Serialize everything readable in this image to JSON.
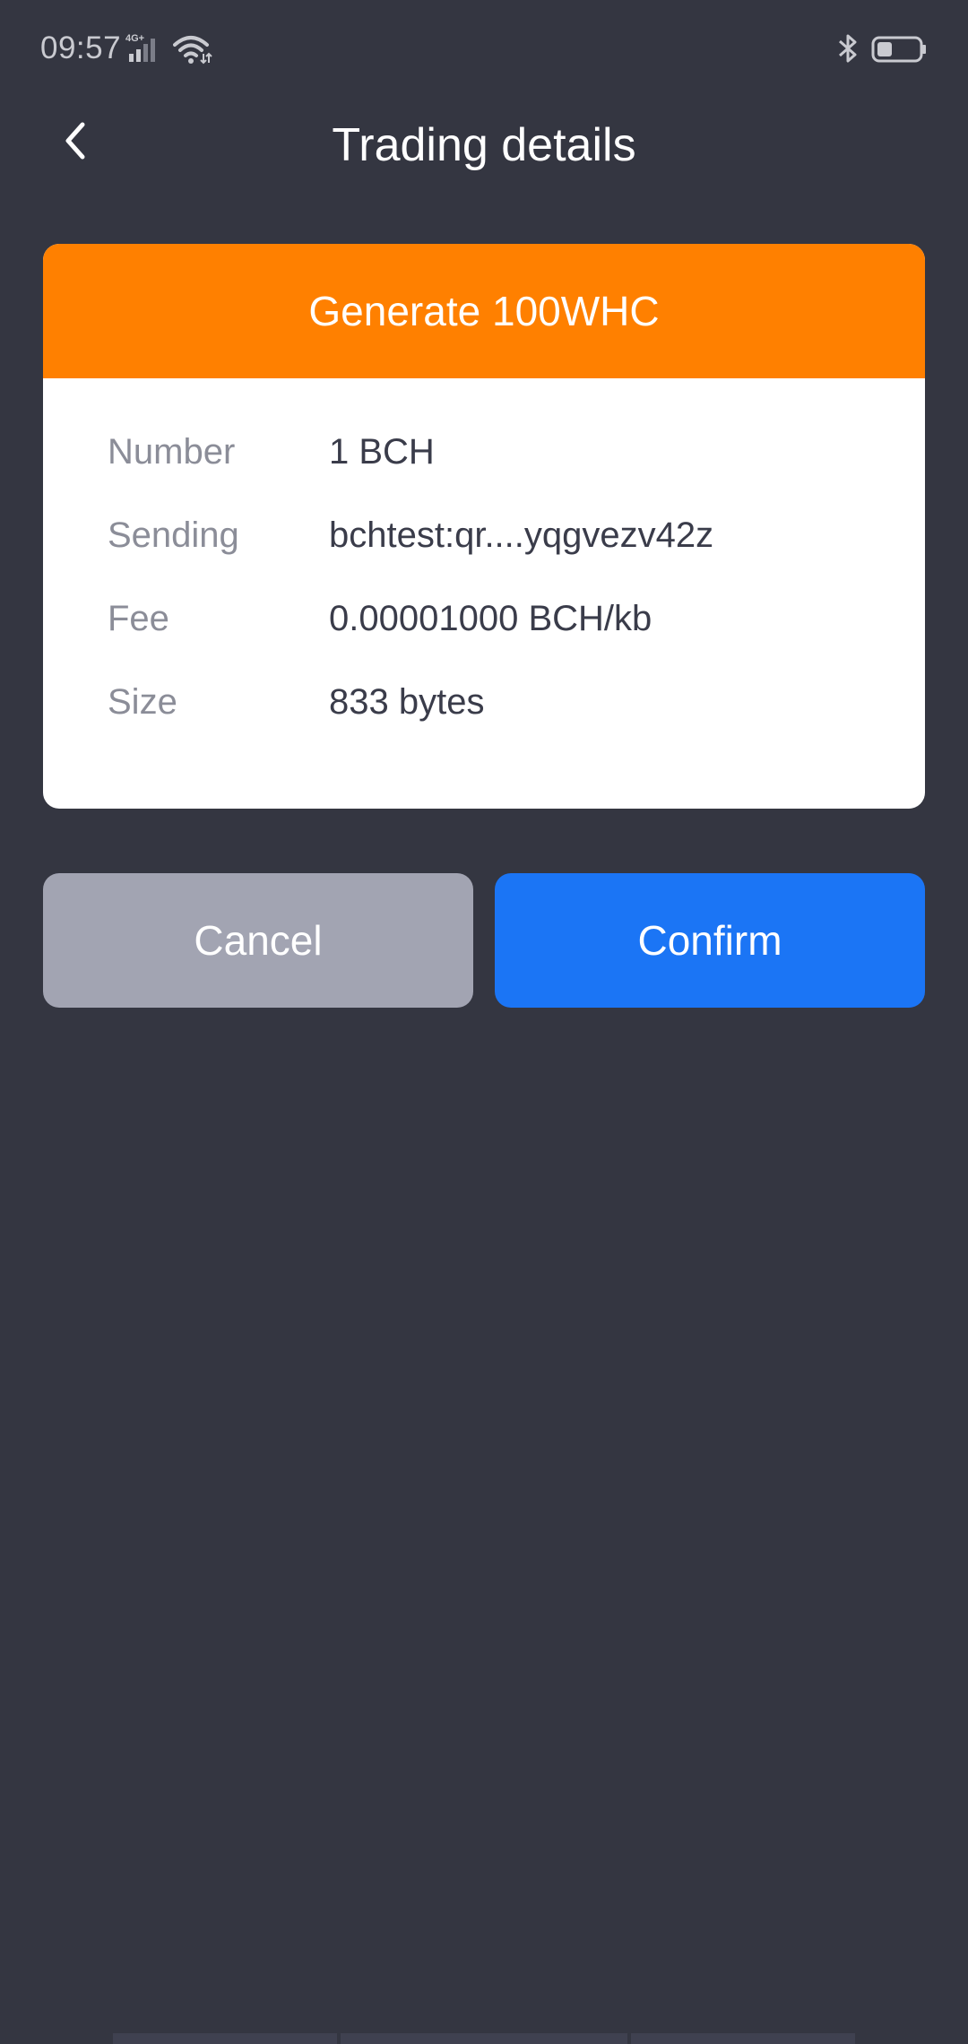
{
  "status_bar": {
    "time": "09:57",
    "network_label": "4G+",
    "icons": [
      "signal-icon",
      "wifi-icon",
      "bluetooth-icon",
      "battery-icon"
    ]
  },
  "header": {
    "title": "Trading details",
    "back_icon": "chevron-left-icon"
  },
  "card": {
    "banner_text": "Generate 100WHC",
    "rows": [
      {
        "label": "Number",
        "value": "1 BCH"
      },
      {
        "label": "Sending",
        "value": "bchtest:qr....yqgvezv42z"
      },
      {
        "label": "Fee",
        "value": "0.00001000 BCH/kb"
      },
      {
        "label": "Size",
        "value": "833 bytes"
      }
    ]
  },
  "actions": {
    "cancel_label": "Cancel",
    "confirm_label": "Confirm"
  },
  "colors": {
    "background": "#343641",
    "banner": "#ff8000",
    "confirm": "#1b75f5",
    "cancel": "#a2a4b2"
  }
}
